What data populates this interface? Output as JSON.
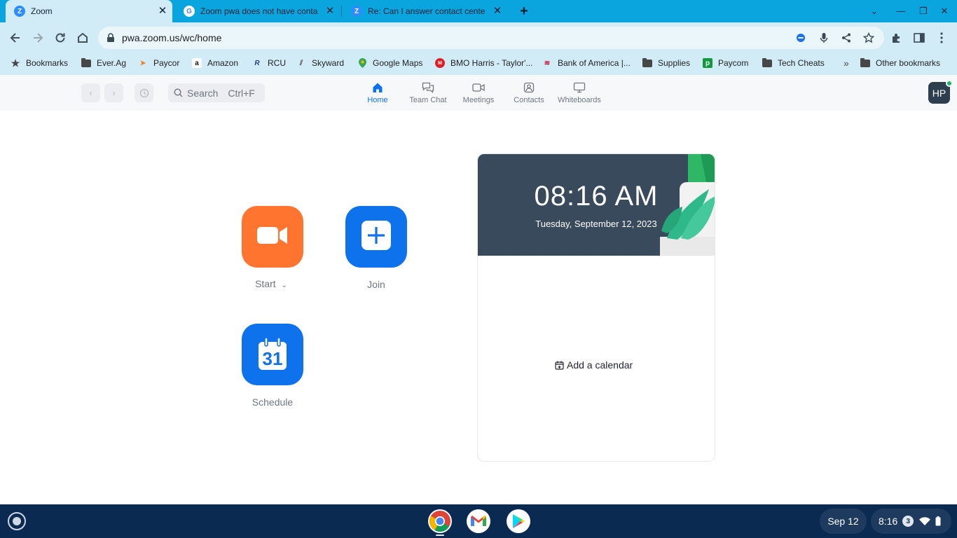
{
  "browser": {
    "tabs": [
      {
        "title": "Zoom",
        "favicon": "zoom-icon"
      },
      {
        "title": "Zoom pwa does not have conta",
        "favicon": "google-icon"
      },
      {
        "title": "Re: Can I answer contact center",
        "favicon": "zoom-icon"
      }
    ],
    "new_tab_glyph": "+",
    "url": "pwa.zoom.us/wc/home",
    "bookmarks": [
      {
        "label": "Bookmarks",
        "icon": "star-icon"
      },
      {
        "label": "Ever.Ag",
        "icon": "folder-icon"
      },
      {
        "label": "Paycor",
        "icon": "paycor-icon"
      },
      {
        "label": "Amazon",
        "icon": "amazon-icon"
      },
      {
        "label": "RCU",
        "icon": "rcu-icon"
      },
      {
        "label": "Skyward",
        "icon": "skyward-icon"
      },
      {
        "label": "Google Maps",
        "icon": "maps-icon"
      },
      {
        "label": "BMO Harris - Taylor'...",
        "icon": "bmo-icon"
      },
      {
        "label": "Bank of America |...",
        "icon": "boa-icon"
      },
      {
        "label": "Supplies",
        "icon": "folder-icon"
      },
      {
        "label": "Paycom",
        "icon": "paycom-icon"
      },
      {
        "label": "Tech Cheats",
        "icon": "folder-icon"
      }
    ],
    "more_bookmarks": "»",
    "other_bookmarks": "Other bookmarks"
  },
  "zoom": {
    "search_label": "Search",
    "search_shortcut": "Ctrl+F",
    "nav_tabs": [
      {
        "label": "Home",
        "icon": "home-icon",
        "active": true
      },
      {
        "label": "Team Chat",
        "icon": "chat-icon",
        "active": false
      },
      {
        "label": "Meetings",
        "icon": "video-icon",
        "active": false
      },
      {
        "label": "Contacts",
        "icon": "contacts-icon",
        "active": false
      },
      {
        "label": "Whiteboards",
        "icon": "whiteboard-icon",
        "active": false
      }
    ],
    "avatar_initials": "HP",
    "actions": {
      "start_label": "Start",
      "join_label": "Join",
      "schedule_label": "Schedule",
      "calendar_day": "31"
    },
    "calendar_card": {
      "time": "08:16 AM",
      "date": "Tuesday, September 12, 2023",
      "add_calendar_label": "Add a calendar"
    },
    "colors": {
      "accent": "#0e72ed",
      "start": "#ff742e",
      "banner": "#394a5c"
    }
  },
  "shelf": {
    "date": "Sep 12",
    "time": "8:16",
    "notification_count": "3"
  }
}
